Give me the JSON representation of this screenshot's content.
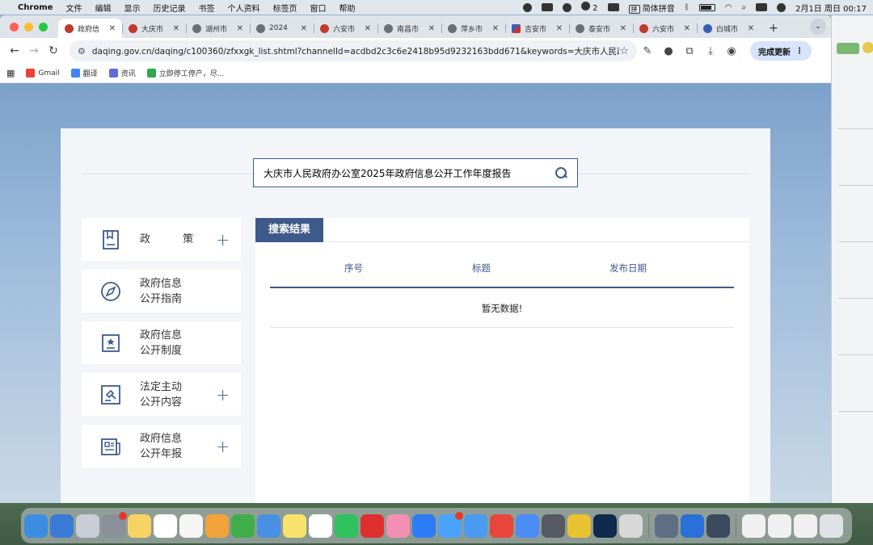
{
  "menubar": {
    "app": "Chrome",
    "items": [
      "文件",
      "编辑",
      "显示",
      "历史记录",
      "书签",
      "个人资料",
      "标签页",
      "窗口",
      "帮助"
    ],
    "wechat_count": "2",
    "ime_label": "拼",
    "ime_name": "简体拼音",
    "datetime": "2月1日 周日",
    "time": "00:17"
  },
  "tabs": [
    {
      "title": "政府信",
      "icon": "gov-emblem-icon",
      "active": true
    },
    {
      "title": "大庆市",
      "icon": "gov-emblem-icon"
    },
    {
      "title": "湖州市",
      "icon": "globe-icon"
    },
    {
      "title": "2024",
      "icon": "globe-icon"
    },
    {
      "title": "六安市",
      "icon": "gov-emblem-icon"
    },
    {
      "title": "南昌市",
      "icon": "globe-icon"
    },
    {
      "title": "萍乡市",
      "icon": "globe-icon"
    },
    {
      "title": "吉安市",
      "icon": "flag-icon"
    },
    {
      "title": "泰安市",
      "icon": "globe-icon"
    },
    {
      "title": "六安市",
      "icon": "gov-emblem-icon"
    },
    {
      "title": "白城市",
      "icon": "paw-icon"
    }
  ],
  "toolbar": {
    "url": "daqing.gov.cn/daqing/c100360/zfxxgk_list.shtml?channelId=acdbd2c3c6e2418b95d9232163bdd671&keywords=大庆市人民政府...",
    "update_button": "完成更新"
  },
  "bookmarks": [
    {
      "label": "Gmail",
      "color": "#ea4335"
    },
    {
      "label": "翻译",
      "color": "#4285f4"
    },
    {
      "label": "资讯",
      "color": "#5b6fd6"
    },
    {
      "label": "立即停工停产，尽...",
      "color": "#2fa84f"
    }
  ],
  "page": {
    "search_value": "大庆市人民政府办公室2025年政府信息公开工作年度报告",
    "sidebar": [
      {
        "line1": "政 策",
        "line2": "",
        "has_plus": true,
        "icon": "document-icon"
      },
      {
        "line1": "政府信息",
        "line2": "公开指南",
        "has_plus": false,
        "icon": "compass-icon"
      },
      {
        "line1": "政府信息",
        "line2": "公开制度",
        "has_plus": false,
        "icon": "rules-icon"
      },
      {
        "line1": "法定主动",
        "line2": "公开内容",
        "has_plus": true,
        "icon": "gavel-icon"
      },
      {
        "line1": "政府信息",
        "line2": "公开年报",
        "has_plus": true,
        "icon": "newspaper-icon"
      }
    ],
    "results_title": "搜索结果",
    "columns": [
      "序号",
      "标题",
      "发布日期"
    ],
    "empty_text": "暂无数据!"
  },
  "colors": {
    "accent": "#3d5a8a"
  }
}
